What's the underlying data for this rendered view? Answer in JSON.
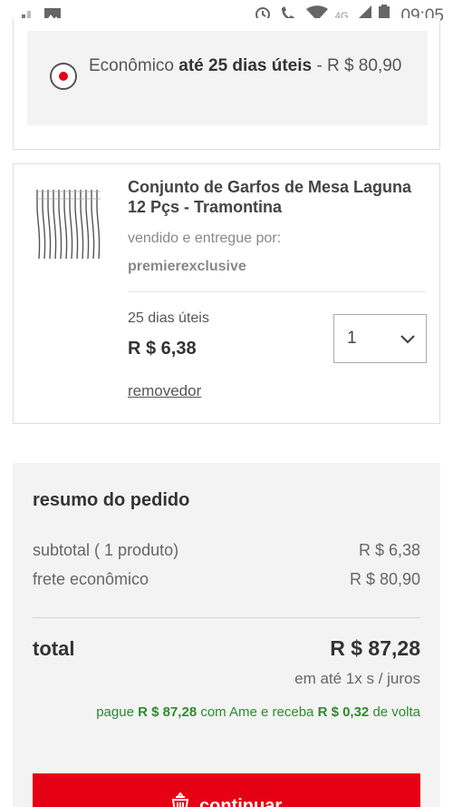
{
  "status_bar": {
    "time": "09:05",
    "network": "4G",
    "icons": [
      "signal-icon",
      "gallery-icon",
      "alarm-icon",
      "volte-icon",
      "wifi-icon",
      "cellular-icon",
      "battery-icon"
    ]
  },
  "shipping_option": {
    "label_prefix": "Econômico ",
    "label_bold": "até 25 dias úteis",
    "label_suffix": " - R $ 80,90",
    "selected": true
  },
  "product": {
    "title": "Conjunto de Garfos de Mesa Laguna 12 Pçs - Tramontina",
    "sold_by_label": "vendido e entregue por:",
    "seller": "premierexclusive",
    "delivery": "25 dias úteis",
    "price": "R $ 6,38",
    "quantity": "1",
    "remove_label": "removedor"
  },
  "summary": {
    "title": "resumo do pedido",
    "subtotal_label": "subtotal ( 1 produto)",
    "subtotal_value": "R $ 6,38",
    "shipping_label": "frete econômico",
    "shipping_value": "R $ 80,90",
    "total_label": "total",
    "total_value": "R $ 87,28",
    "installments": "em até 1x s / juros",
    "ame_pre": "pague ",
    "ame_amount": "R $ 87,28",
    "ame_mid": " com Ame e receba ",
    "ame_cashback": "R $ 0,32",
    "ame_post": " de volta",
    "continue_label": "continuar"
  },
  "colors": {
    "brand_red": "#e60014",
    "ame_green": "#2e8b2e"
  }
}
